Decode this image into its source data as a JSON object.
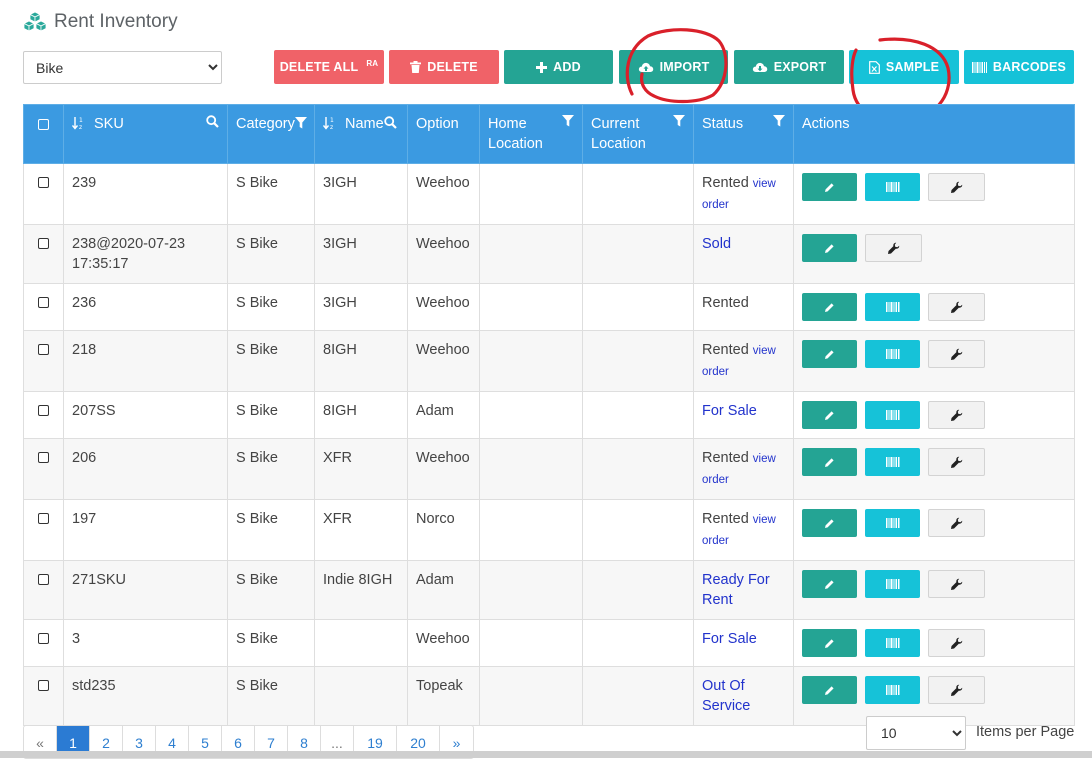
{
  "page": {
    "title": "Rent Inventory",
    "title_icon": "boxes-icon"
  },
  "category_filter": {
    "selected": "Bike"
  },
  "toolbar": {
    "delete_all": "DELETE ALL",
    "delete_all_sup": "RA",
    "delete": "DELETE",
    "add": "ADD",
    "import": "IMPORT",
    "export": "EXPORT",
    "sample": "SAMPLE",
    "barcodes": "BARCODES"
  },
  "table": {
    "headers": {
      "sku": "SKU",
      "category": "Category",
      "name": "Name",
      "option": "Option",
      "home_location": "Home Location",
      "current_location": "Current Location",
      "status": "Status",
      "actions": "Actions"
    },
    "rows": [
      {
        "sku": "239",
        "category": "S Bike",
        "name": "3IGH",
        "option": "Weehoo",
        "home": "",
        "current": "",
        "status": "Rented",
        "status_link": "view order",
        "status_type": "rented",
        "actions": [
          "edit",
          "barcode",
          "wrench"
        ]
      },
      {
        "sku": "238@2020-07-23 17:35:17",
        "category": "S Bike",
        "name": "3IGH",
        "option": "Weehoo",
        "home": "",
        "current": "",
        "status": "Sold",
        "status_link": "",
        "status_type": "link",
        "actions": [
          "edit",
          "wrench"
        ]
      },
      {
        "sku": "236",
        "category": "S Bike",
        "name": "3IGH",
        "option": "Weehoo",
        "home": "",
        "current": "",
        "status": "Rented",
        "status_link": "",
        "status_type": "plain",
        "actions": [
          "edit",
          "barcode",
          "wrench"
        ]
      },
      {
        "sku": "218",
        "category": "S Bike",
        "name": "8IGH",
        "option": "Weehoo",
        "home": "",
        "current": "",
        "status": "Rented",
        "status_link": "view order",
        "status_type": "rented",
        "actions": [
          "edit",
          "barcode",
          "wrench"
        ]
      },
      {
        "sku": "207SS",
        "category": "S Bike",
        "name": "8IGH",
        "option": "Adam",
        "home": "",
        "current": "",
        "status": "For Sale",
        "status_link": "",
        "status_type": "link",
        "actions": [
          "edit",
          "barcode",
          "wrench"
        ]
      },
      {
        "sku": "206",
        "category": "S Bike",
        "name": "XFR",
        "option": "Weehoo",
        "home": "",
        "current": "",
        "status": "Rented",
        "status_link": "view order",
        "status_type": "rented",
        "actions": [
          "edit",
          "barcode",
          "wrench"
        ]
      },
      {
        "sku": "197",
        "category": "S Bike",
        "name": "XFR",
        "option": "Norco",
        "home": "",
        "current": "",
        "status": "Rented",
        "status_link": "view order",
        "status_type": "rented",
        "actions": [
          "edit",
          "barcode",
          "wrench"
        ]
      },
      {
        "sku": "271SKU",
        "category": "S Bike",
        "name": "Indie 8IGH",
        "option": "Adam",
        "home": "",
        "current": "",
        "status": "Ready For Rent",
        "status_link": "",
        "status_type": "link",
        "actions": [
          "edit",
          "barcode",
          "wrench"
        ]
      },
      {
        "sku": "3",
        "category": "S Bike",
        "name": "",
        "option": "Weehoo",
        "home": "",
        "current": "",
        "status": "For Sale",
        "status_link": "",
        "status_type": "link",
        "actions": [
          "edit",
          "barcode",
          "wrench"
        ]
      },
      {
        "sku": "std235",
        "category": "S Bike",
        "name": "",
        "option": "Topeak",
        "home": "",
        "current": "",
        "status": "Out Of Service",
        "status_link": "",
        "status_type": "link",
        "actions": [
          "edit",
          "barcode",
          "wrench"
        ]
      }
    ]
  },
  "pagination": {
    "prev": "«",
    "next": "»",
    "pages": [
      "1",
      "2",
      "3",
      "4",
      "5",
      "6",
      "7",
      "8",
      "...",
      "19",
      "20"
    ],
    "current": "1"
  },
  "per_page": {
    "selected": "10",
    "label": "Items per Page"
  },
  "colors": {
    "header": "#3b9ae1",
    "teal": "#24a494",
    "cyan": "#16c2d8",
    "red": "#f06268",
    "link": "#2233cc",
    "annotation": "#d9202a"
  }
}
